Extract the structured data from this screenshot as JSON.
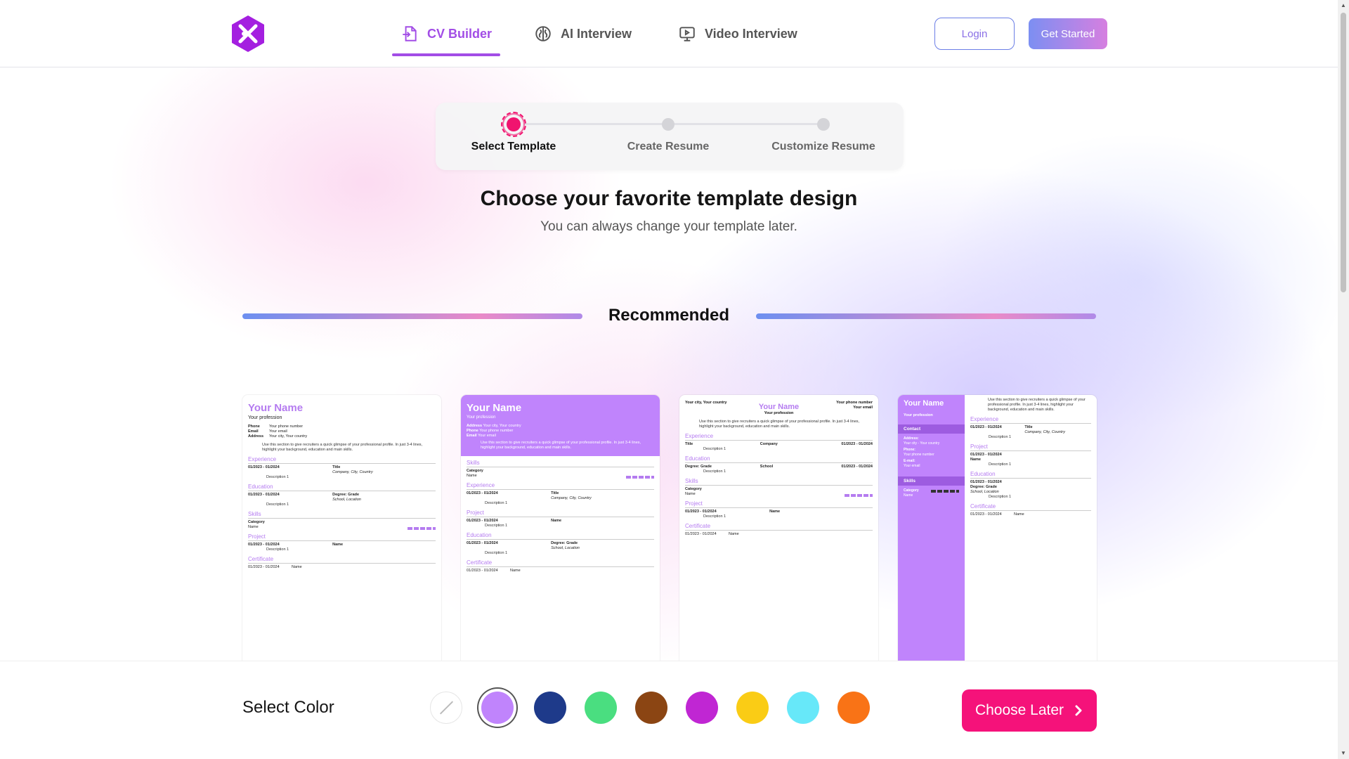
{
  "nav": {
    "items": [
      {
        "label": "CV Builder",
        "icon": "file-import-icon"
      },
      {
        "label": "AI Interview",
        "icon": "brain-icon"
      },
      {
        "label": "Video Interview",
        "icon": "monitor-icon"
      }
    ],
    "active_index": 0,
    "login_label": "Login",
    "get_started_label": "Get Started"
  },
  "stepper": {
    "steps": [
      "Select Template",
      "Create Resume",
      "Customize Resume"
    ],
    "active_index": 0
  },
  "heading": {
    "title": "Choose your favorite template design",
    "subtitle": "You can always change your template later."
  },
  "section_label": "Recommended",
  "templates": {
    "name": "Your Name",
    "profession": "Your profession",
    "labels": {
      "phone": "Phone",
      "email": "Email",
      "address": "Address",
      "phone_val": "Your phone number",
      "email_val": "Your email",
      "address_val": "Your city, Your country",
      "summary": "Use this section to give recruiters a quick glimpse of your professional profile. In just 3-4 lines, highlight your background, education and main skills.",
      "experience": "Experience",
      "education": "Education",
      "skills": "Skills",
      "project": "Project",
      "certificate": "Certificate",
      "contact": "Contact",
      "date": "01/2023 - 01/2024",
      "title": "Title",
      "company_loc": "Company, City, Country",
      "company": "Company",
      "description": "Description 1",
      "degree": "Degree: Grade",
      "school_loc": "School, Location",
      "school": "School",
      "category": "Category",
      "name_small": "Name",
      "name": "Name",
      "city_country": "Your city, Your country",
      "address_colon": "Address:",
      "phone_colon": "Phone:",
      "email_colon": "E-mail:",
      "phone_num": "Your phone number",
      "your_email": "Your email",
      "city_dash": "Your city - Your country",
      "right_phone": "Your phone number",
      "right_email": "Your email"
    }
  },
  "colors": {
    "label": "Select Color",
    "swatches": [
      "none",
      "#c084fc",
      "#1e3a8a",
      "#4ade80",
      "#8b4513",
      "#c026d3",
      "#facc15",
      "#67e8f9",
      "#f97316"
    ],
    "selected_index": 1
  },
  "choose_later_label": "Choose Later",
  "brand": {
    "accent": "#a24de6",
    "primary_button": "#f5127a"
  }
}
